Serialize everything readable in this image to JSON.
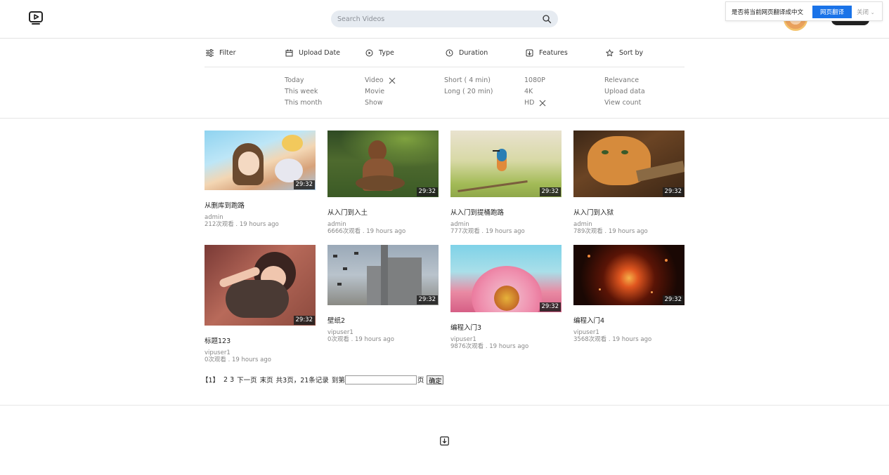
{
  "header": {
    "search_placeholder": "Search Videos"
  },
  "translate_bar": {
    "prompt": "是否将当前网页翻译成中文",
    "translate_label": "网页翻译",
    "close_label": "关闭"
  },
  "filter": {
    "headers": [
      "Filter",
      "Upload Date",
      "Type",
      "Duration",
      "Features",
      "Sort by"
    ],
    "upload_date": [
      "Today",
      "This week",
      "This month"
    ],
    "type": [
      "Video",
      "Movie",
      "Show"
    ],
    "duration": [
      "Short ( 4 min)",
      "Long ( 20 min)"
    ],
    "features": [
      "1080P",
      "4K",
      "HD"
    ],
    "sort_by": [
      "Relevance",
      "Upload data",
      "View count"
    ]
  },
  "videos": [
    {
      "title": "从删库到跑路",
      "author": "admin",
      "meta": "212次观看 . 19 hours ago",
      "duration": "29:32"
    },
    {
      "title": "从入门到入土",
      "author": "admin",
      "meta": "6666次观看 . 19 hours ago",
      "duration": "29:32"
    },
    {
      "title": "从入门到提桶跑路",
      "author": "admin",
      "meta": "777次观看 . 19 hours ago",
      "duration": "29:32"
    },
    {
      "title": "从入门到入狱",
      "author": "admin",
      "meta": "789次观看 . 19 hours ago",
      "duration": "29:32"
    },
    {
      "title": "标题123",
      "author": "vipuser1",
      "meta": "0次观看 . 19 hours ago",
      "duration": "29:32"
    },
    {
      "title": "壁纸2",
      "author": "vipuser1",
      "meta": "0次观看 . 19 hours ago",
      "duration": "29:32"
    },
    {
      "title": "编程入门3",
      "author": "vipuser1",
      "meta": "9876次观看 . 19 hours ago",
      "duration": "29:32"
    },
    {
      "title": "编程入门4",
      "author": "vipuser1",
      "meta": "3568次观看 . 19 hours ago",
      "duration": "29:32"
    }
  ],
  "pager": {
    "current": "【1】",
    "pages": [
      "2",
      "3"
    ],
    "next": "下一页",
    "last": "末页",
    "summary": "共3页，21条记录",
    "goto": "到第",
    "page_unit": "页",
    "ok": "确定"
  },
  "icons": {
    "logo": "play-icon",
    "search": "search-icon",
    "footer": "download-icon"
  }
}
